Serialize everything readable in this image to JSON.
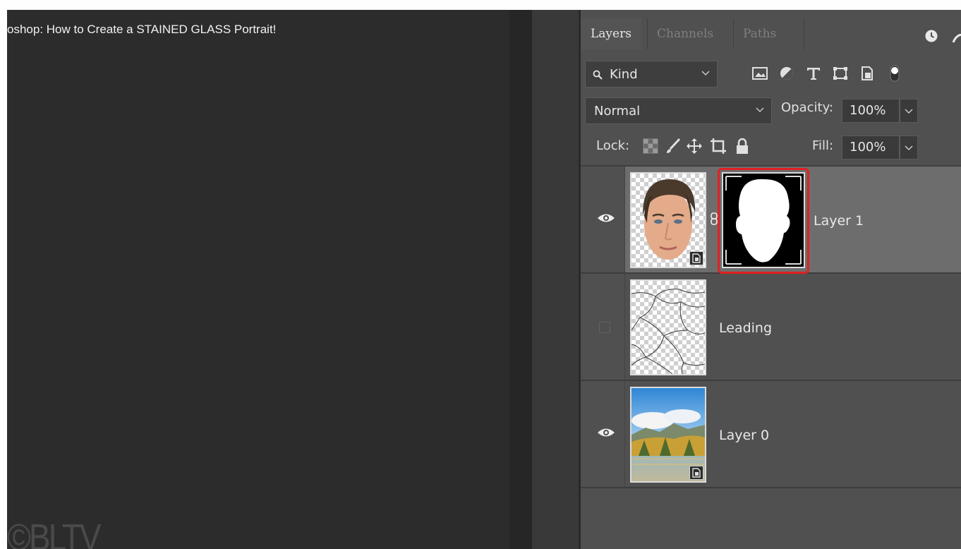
{
  "video": {
    "title": "oshop: How to Create a STAINED GLASS Portrait!",
    "watermark": "©BLTV"
  },
  "layers_panel": {
    "tabs": [
      {
        "label": "Layers",
        "active": true
      },
      {
        "label": "Channels",
        "active": false
      },
      {
        "label": "Paths",
        "active": false
      }
    ],
    "filter": {
      "kind_label": "Kind",
      "filter_icons": [
        "image-filter-icon",
        "adjustment-filter-icon",
        "type-filter-icon",
        "shape-filter-icon",
        "smart-object-filter-icon",
        "filter-toggle-icon"
      ]
    },
    "blend_mode": "Normal",
    "opacity_label": "Opacity:",
    "opacity_value": "100%",
    "lock_label": "Lock:",
    "lock_icons": [
      "lock-transparent-pixels-icon",
      "lock-image-pixels-icon",
      "lock-position-icon",
      "lock-artboard-icon",
      "lock-all-icon"
    ],
    "fill_label": "Fill:",
    "fill_value": "100%",
    "layers": [
      {
        "name": "Layer 1",
        "visible": true,
        "selected": true,
        "has_mask": true,
        "mask_highlighted": true
      },
      {
        "name": "Leading",
        "visible": false,
        "selected": false,
        "has_mask": false
      },
      {
        "name": "Layer 0",
        "visible": true,
        "selected": false,
        "has_mask": false
      }
    ]
  },
  "colors": {
    "panel_bg": "#505050",
    "selected_row": "#6d6d6d",
    "highlight": "#e22121"
  }
}
